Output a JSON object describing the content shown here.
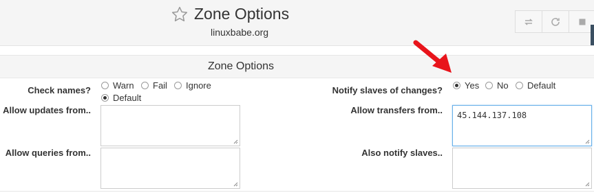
{
  "header": {
    "title": "Zone Options",
    "subtitle": "linuxbabe.org"
  },
  "section": {
    "title": "Zone Options"
  },
  "check_names": {
    "label": "Check names?",
    "options": [
      "Warn",
      "Fail",
      "Ignore",
      "Default"
    ],
    "selected": "Default"
  },
  "notify_slaves": {
    "label": "Notify slaves of changes?",
    "options": [
      "Yes",
      "No",
      "Default"
    ],
    "selected": "Yes"
  },
  "allow_updates": {
    "label": "Allow updates from..",
    "value": ""
  },
  "allow_transfers": {
    "label": "Allow transfers from..",
    "value": "45.144.137.108"
  },
  "allow_queries": {
    "label": "Allow queries from..",
    "value": ""
  },
  "also_notify": {
    "label": "Also notify slaves..",
    "value": ""
  },
  "icons": [
    "star-icon",
    "transfer-icon",
    "refresh-icon",
    "stop-icon",
    "red-arrow-annotation"
  ],
  "colors": {
    "accent_focus": "#66afe9",
    "annotation_arrow": "#e8141b"
  }
}
